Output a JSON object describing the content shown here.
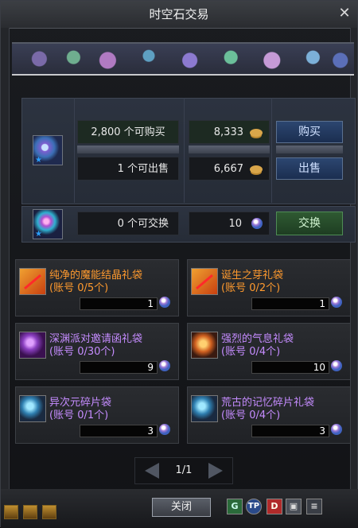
{
  "window": {
    "title": "时空石交易"
  },
  "trade": {
    "buy_available": "2,800 个可购买",
    "buy_price": "8,333",
    "buy_button": "购买",
    "sell_available": "1 个可出售",
    "sell_price": "6,667",
    "sell_button": "出售",
    "exchange_available": "0 个可交换",
    "exchange_cost": "10",
    "exchange_button": "交换"
  },
  "items": [
    {
      "name": "纯净的魔能结晶礼袋",
      "limit": "(账号 0/5个)",
      "qty": "1",
      "name_color": "orange",
      "icon": "red-cross-bag-icon"
    },
    {
      "name": "诞生之芽礼袋",
      "limit": "(账号 0/2个)",
      "qty": "1",
      "name_color": "orange",
      "icon": "red-cross-bag-icon"
    },
    {
      "name": "深渊派对邀请函礼袋",
      "limit": "(账号 0/30个)",
      "qty": "9",
      "name_color": "violet",
      "icon": "purple-skull-icon"
    },
    {
      "name": "强烈的气息礼袋",
      "limit": "(账号 0/4个)",
      "qty": "10",
      "name_color": "violet",
      "icon": "flame-hero-icon"
    },
    {
      "name": "异次元碎片袋",
      "limit": "(账号 0/1个)",
      "qty": "3",
      "name_color": "violet",
      "icon": "dimension-shard-icon"
    },
    {
      "name": "荒古的记忆碎片礼袋",
      "limit": "(账号 0/4个)",
      "qty": "3",
      "name_color": "violet",
      "icon": "memory-shard-icon"
    }
  ],
  "pager": {
    "label": "1/1"
  },
  "footer": {
    "close_button": "关闭",
    "shortcut_g": "G",
    "shortcut_tp": "TP",
    "shortcut_d": "D"
  },
  "colors": {
    "orange_text": "#ff9a2e",
    "violet_text": "#c58cff",
    "buy_button": "#2c4670",
    "exchange_button": "#2f5a32"
  }
}
